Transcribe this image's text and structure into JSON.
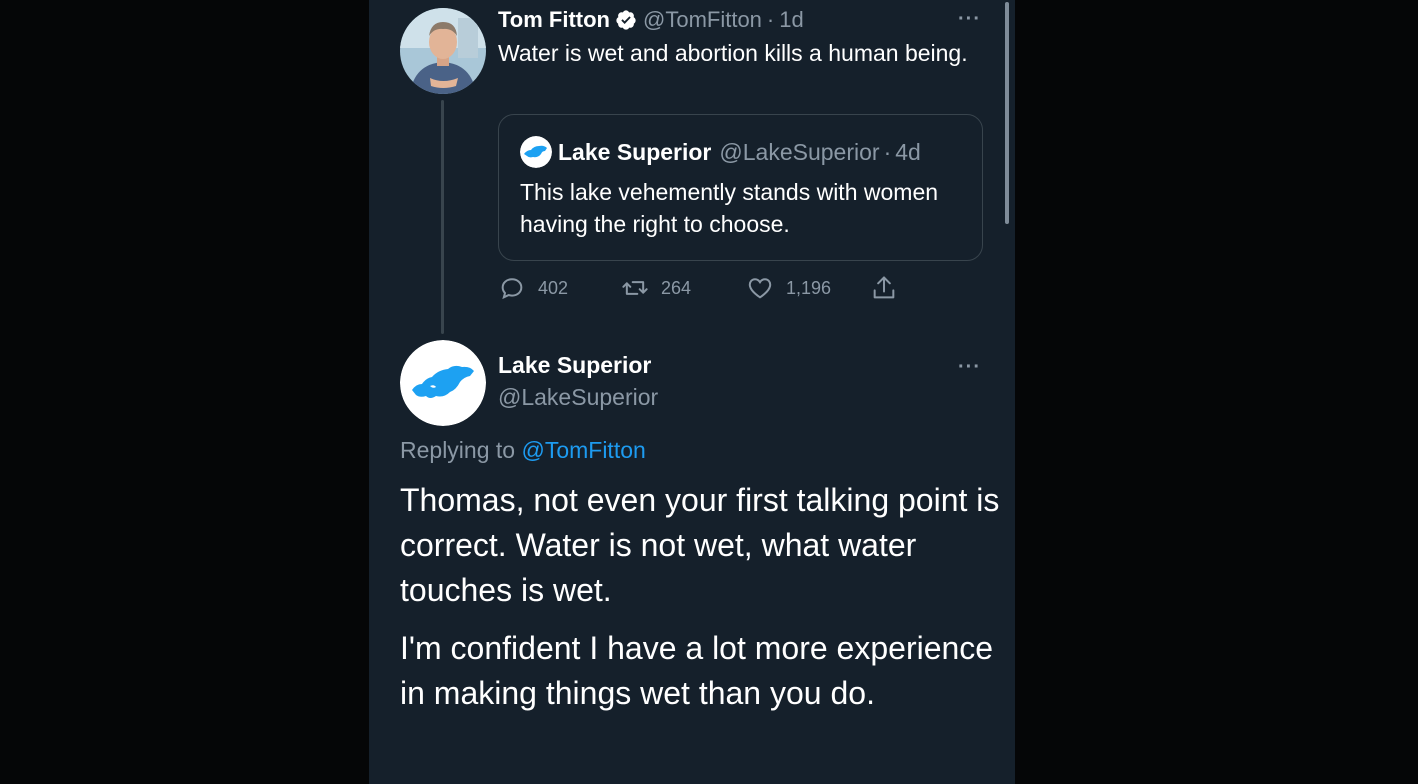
{
  "tweet": {
    "author_name": "Tom Fitton",
    "author_handle": "@TomFitton",
    "time_separator": "·",
    "time": "1d",
    "text": "Water is wet and abortion kills a human being.",
    "more_icon": "more-dots-icon",
    "verified_icon": "verified-badge-icon",
    "quote": {
      "author_name": "Lake Superior",
      "author_handle": "@LakeSuperior",
      "time_separator": "·",
      "time": "4d",
      "text": "This lake vehemently stands with women having the right to choose."
    },
    "stats": {
      "replies": "402",
      "retweets": "264",
      "likes": "1,196"
    }
  },
  "reply": {
    "author_name": "Lake Superior",
    "author_handle": "@LakeSuperior",
    "replying_prefix": "Replying to",
    "replying_to": "@TomFitton",
    "paragraphs": [
      "Thomas, not even your first talking point is correct. Water is not wet, what water touches is wet.",
      "I'm confident I have a lot more experience in making things wet than you do."
    ]
  },
  "colors": {
    "background": "#15202b",
    "text": "#ffffff",
    "muted": "#8b98a5",
    "link": "#1d9bf0",
    "border": "#38444d",
    "lake_blue": "#1da1f2"
  }
}
